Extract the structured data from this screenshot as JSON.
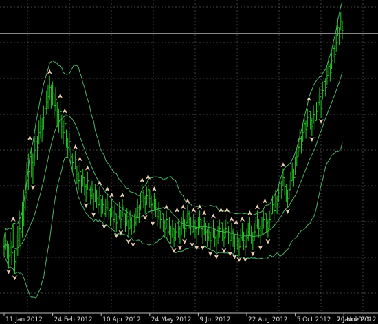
{
  "window": {
    "background": "#000000",
    "grid_color": "#7a7a7a",
    "axis_color": "#bcbcbc"
  },
  "colors": {
    "bar": "#22cc22",
    "band": "#4fb56c",
    "fractal_up": "#e8d0b0",
    "fractal_down": "#e8d0b0",
    "tick_text": "#d8d8d8",
    "price_line": "#9a9a9a"
  },
  "chart_data": {
    "type": "ohlc_bars_with_bollinger_bands_and_fractals",
    "x_axis_labels": [
      "11 Jan 2012",
      "24 Feb 2012",
      "10 Apr 2012",
      "24 May 2012",
      "9 Jul 2012",
      "22 Aug 2012",
      "5 Oct 2012",
      "20 Nov 2012",
      "7 Jan 2013"
    ],
    "x_axis_label_index": [
      0,
      32,
      64,
      96,
      128,
      160,
      192,
      224,
      256
    ],
    "price_ylim": [
      0,
      100
    ],
    "grid": true,
    "horizontal_price_line_level": 93,
    "close_series": [
      22,
      24,
      21,
      19,
      23,
      20,
      26,
      17,
      21,
      24,
      28,
      27,
      31,
      35,
      40,
      44,
      47,
      52,
      50,
      48,
      54,
      57,
      55,
      60,
      62,
      61,
      65,
      68,
      70,
      72,
      75,
      72,
      73,
      69,
      71,
      66,
      64,
      67,
      62,
      60,
      63,
      58,
      55,
      57,
      52,
      50,
      48,
      51,
      46,
      44,
      47,
      43,
      45,
      42,
      40,
      44,
      41,
      39,
      41,
      37,
      40,
      38,
      36,
      39,
      35,
      36,
      33,
      35,
      37,
      34,
      32,
      35,
      31,
      33,
      30,
      32,
      34,
      31,
      35,
      33,
      30,
      32,
      28,
      31,
      29,
      27,
      30,
      32,
      35,
      33,
      37,
      40,
      38,
      36,
      39,
      41,
      38,
      36,
      34,
      37,
      35,
      32,
      34,
      31,
      33,
      30,
      28,
      31,
      27,
      29,
      26,
      28,
      25,
      27,
      30,
      28,
      26,
      29,
      31,
      28,
      30,
      33,
      31,
      29,
      27,
      30,
      28,
      26,
      29,
      31,
      28,
      26,
      29,
      27,
      25,
      27,
      24,
      26,
      28,
      25,
      23,
      26,
      28,
      30,
      27,
      25,
      28,
      30,
      26,
      24,
      27,
      25,
      23,
      26,
      24,
      22,
      25,
      27,
      24,
      22,
      25,
      27,
      29,
      26,
      24,
      27,
      29,
      31,
      28,
      26,
      29,
      31,
      33,
      30,
      28,
      31,
      33,
      36,
      34,
      38,
      36,
      40,
      43,
      41,
      45,
      42,
      40,
      38,
      41,
      44,
      47,
      45,
      49,
      52,
      55,
      58,
      56,
      60,
      63,
      61,
      65,
      67,
      64,
      62,
      66,
      64,
      67,
      70,
      72,
      68,
      74,
      77,
      75,
      79,
      82,
      80,
      84,
      88,
      86,
      90,
      95,
      92,
      97,
      94
    ],
    "volatility_series": [
      3,
      3,
      3,
      4,
      4,
      4,
      4,
      4,
      5,
      5,
      6,
      6,
      6,
      6,
      6,
      6,
      6,
      5,
      5,
      5,
      5,
      5,
      4,
      4,
      4,
      4,
      4,
      4,
      4,
      4,
      4,
      4,
      4,
      4,
      4,
      4,
      4,
      4,
      4,
      4,
      3,
      3,
      3,
      3,
      3,
      3,
      3,
      3,
      3,
      3,
      3,
      3,
      3,
      3,
      3,
      3,
      3,
      3,
      3,
      3,
      3,
      3,
      3,
      3,
      3,
      3,
      3,
      3,
      3,
      3,
      3,
      3,
      3,
      3,
      3,
      3,
      3,
      3,
      3,
      3,
      3,
      3,
      3,
      3,
      3,
      3,
      3,
      3,
      3,
      3,
      3,
      3,
      3,
      3,
      3,
      3,
      3,
      3,
      3,
      3,
      3,
      3,
      3,
      3,
      3,
      3,
      3,
      3,
      3,
      3,
      3,
      3,
      3,
      3,
      3,
      3,
      3,
      3,
      3,
      3,
      3,
      3,
      3,
      3,
      3,
      3,
      3,
      3,
      3,
      3,
      3,
      3,
      3,
      3,
      3,
      3,
      3,
      3,
      3,
      3,
      3,
      3,
      3,
      3,
      3,
      3,
      3,
      3,
      3,
      3,
      3,
      3,
      3,
      3,
      3,
      3,
      3,
      3,
      3,
      3,
      3,
      3,
      3,
      3,
      3,
      3,
      3,
      3,
      3,
      3,
      3,
      3,
      3,
      3,
      3,
      3,
      3,
      3,
      3,
      3,
      3,
      3,
      3,
      3,
      3,
      3,
      3,
      3,
      3,
      3,
      3,
      3,
      3,
      3,
      3,
      3,
      3,
      3,
      3,
      3,
      3,
      3,
      3,
      3,
      3,
      3,
      3,
      3,
      3,
      3,
      3,
      3,
      3,
      3,
      3,
      3,
      3,
      3,
      3,
      3,
      3,
      3,
      3,
      3,
      3,
      3,
      3,
      3,
      3,
      3,
      3,
      3,
      3,
      3,
      3,
      3,
      3,
      3,
      3,
      3,
      3,
      3,
      3,
      3,
      3,
      3,
      3,
      3,
      3,
      3,
      3,
      3,
      3,
      3,
      3,
      3,
      3,
      3,
      3,
      3,
      3,
      3,
      3,
      3,
      3,
      3,
      3,
      3
    ]
  }
}
